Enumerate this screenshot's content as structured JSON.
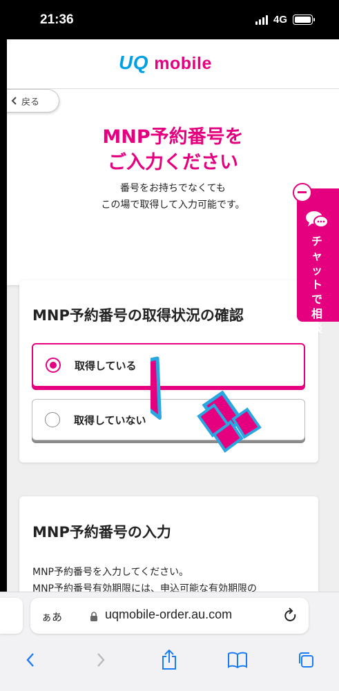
{
  "status_bar": {
    "time": "21:36",
    "network": "4G"
  },
  "header": {
    "logo_uq": "UQ",
    "logo_mobile": "mobile"
  },
  "hero": {
    "back_label": "戻る",
    "title_line1": "MNP予約番号を",
    "title_line2": "ご入力ください",
    "sub_line1": "番号をお持ちでなくても",
    "sub_line2": "この場で取得して入力可能です。"
  },
  "status_card": {
    "title": "MNP予約番号の取得状況の確認",
    "options": [
      {
        "label": "取得している",
        "selected": true
      },
      {
        "label": "取得していない",
        "selected": false
      }
    ]
  },
  "input_card": {
    "title": "MNP予約番号の入力",
    "line1": "MNP予約番号を入力してください。",
    "line2": "MNP予約番号有効期限には、申込可能な有効期限の"
  },
  "chat_tab": {
    "label": "チャットで相談"
  },
  "browser": {
    "aa": "ぁあ",
    "url": "uqmobile-order.au.com"
  },
  "colors": {
    "accent": "#e4007f",
    "brand_blue": "#00a0e4",
    "arrow_outline": "#2aa7e0"
  }
}
